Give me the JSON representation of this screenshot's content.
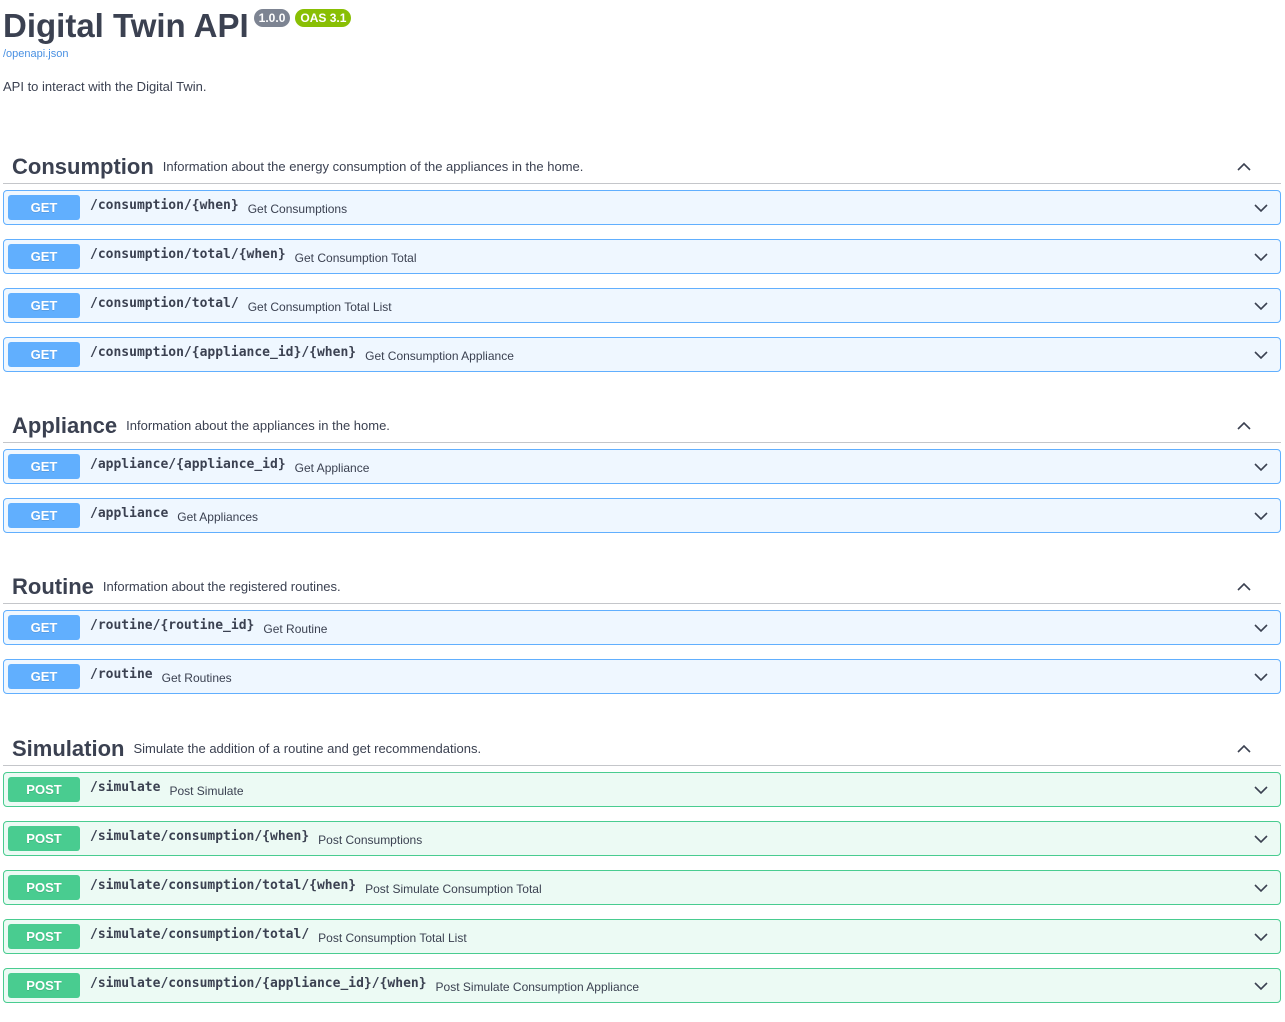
{
  "info": {
    "title": "Digital Twin API",
    "version": "1.0.0",
    "oas": "OAS 3.1",
    "spec_link": "/openapi.json",
    "description": "API to interact with the Digital Twin."
  },
  "colors": {
    "get": "#61affe",
    "post": "#49cc90",
    "version_badge": "#7d8492",
    "oas_badge": "#89bf04",
    "link": "#4990e2"
  },
  "icons": {
    "tag_toggle": "chevron-up-icon",
    "op_toggle": "chevron-down-icon"
  },
  "tags": [
    {
      "name": "Consumption",
      "description": "Information about the energy consumption of the appliances in the home.",
      "operations": [
        {
          "method": "GET",
          "path": "/consumption/{when}",
          "summary": "Get Consumptions"
        },
        {
          "method": "GET",
          "path": "/consumption/total/{when}",
          "summary": "Get Consumption Total"
        },
        {
          "method": "GET",
          "path": "/consumption/total/",
          "summary": "Get Consumption Total List"
        },
        {
          "method": "GET",
          "path": "/consumption/{appliance_id}/{when}",
          "summary": "Get Consumption Appliance"
        }
      ]
    },
    {
      "name": "Appliance",
      "description": "Information about the appliances in the home.",
      "operations": [
        {
          "method": "GET",
          "path": "/appliance/{appliance_id}",
          "summary": "Get Appliance"
        },
        {
          "method": "GET",
          "path": "/appliance",
          "summary": "Get Appliances"
        }
      ]
    },
    {
      "name": "Routine",
      "description": "Information about the registered routines.",
      "operations": [
        {
          "method": "GET",
          "path": "/routine/{routine_id}",
          "summary": "Get Routine"
        },
        {
          "method": "GET",
          "path": "/routine",
          "summary": "Get Routines"
        }
      ]
    },
    {
      "name": "Simulation",
      "description": "Simulate the addition of a routine and get recommendations.",
      "operations": [
        {
          "method": "POST",
          "path": "/simulate",
          "summary": "Post Simulate"
        },
        {
          "method": "POST",
          "path": "/simulate/consumption/{when}",
          "summary": "Post Consumptions"
        },
        {
          "method": "POST",
          "path": "/simulate/consumption/total/{when}",
          "summary": "Post Simulate Consumption Total"
        },
        {
          "method": "POST",
          "path": "/simulate/consumption/total/",
          "summary": "Post Consumption Total List"
        },
        {
          "method": "POST",
          "path": "/simulate/consumption/{appliance_id}/{when}",
          "summary": "Post Simulate Consumption Appliance"
        }
      ]
    }
  ]
}
